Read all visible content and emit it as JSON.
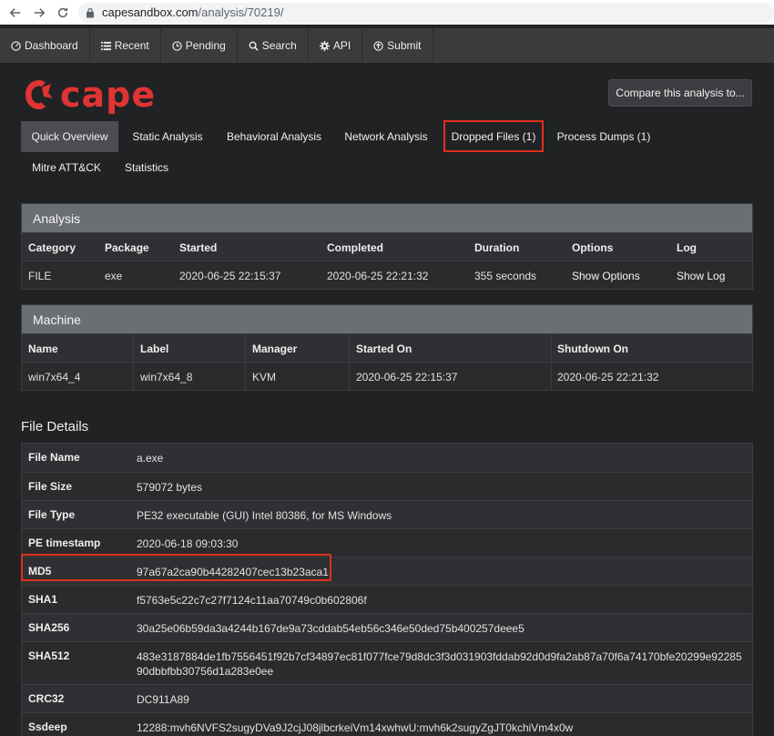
{
  "browser": {
    "url_host": "capesandbox.com",
    "url_path": "/analysis/70219/"
  },
  "nav": [
    {
      "label": "Dashboard",
      "icon": "dashboard-icon"
    },
    {
      "label": "Recent",
      "icon": "list-icon"
    },
    {
      "label": "Pending",
      "icon": "clock-icon"
    },
    {
      "label": "Search",
      "icon": "search-icon"
    },
    {
      "label": "API",
      "icon": "gear-icon"
    },
    {
      "label": "Submit",
      "icon": "upload-icon"
    }
  ],
  "logo_text": "cape",
  "compare_label": "Compare this analysis to...",
  "tabs": [
    {
      "label": "Quick Overview",
      "active": true
    },
    {
      "label": "Static Analysis"
    },
    {
      "label": "Behavioral Analysis"
    },
    {
      "label": "Network Analysis"
    },
    {
      "label": "Dropped Files (1)",
      "highlighted": true
    },
    {
      "label": "Process Dumps (1)"
    },
    {
      "label": "Mitre ATT&CK"
    },
    {
      "label": "Statistics"
    }
  ],
  "analysis": {
    "title": "Analysis",
    "headers": [
      "Category",
      "Package",
      "Started",
      "Completed",
      "Duration",
      "Options",
      "Log"
    ],
    "values": [
      "FILE",
      "exe",
      "2020-06-25 22:15:37",
      "2020-06-25 22:21:32",
      "355 seconds",
      "Show Options",
      "Show Log"
    ]
  },
  "machine": {
    "title": "Machine",
    "headers": [
      "Name",
      "Label",
      "Manager",
      "Started On",
      "Shutdown On"
    ],
    "values": [
      "win7x64_4",
      "win7x64_8",
      "KVM",
      "2020-06-25 22:15:37",
      "2020-06-25 22:21:32"
    ]
  },
  "file_details": {
    "title": "File Details",
    "rows": [
      {
        "key": "File Name",
        "value": "a.exe"
      },
      {
        "key": "File Size",
        "value": "579072 bytes"
      },
      {
        "key": "File Type",
        "value": "PE32 executable (GUI) Intel 80386, for MS Windows"
      },
      {
        "key": "PE timestamp",
        "value": "2020-06-18 09:03:30"
      },
      {
        "key": "MD5",
        "value": "97a67a2ca90b44282407cec13b23aca1",
        "highlighted": true
      },
      {
        "key": "SHA1",
        "value": "f5763e5c22c7c27f7124c11aa70749c0b602806f"
      },
      {
        "key": "SHA256",
        "value": "30a25e06b59da3a4244b167de9a73cddab54eb56c346e50ded75b400257deee5"
      },
      {
        "key": "SHA512",
        "value": "483e3187884de1fb7556451f92b7cf34897ec81f077fce79d8dc3f3d031903fddab92d0d9fa2ab87a70f6a74170bfe20299e9228590dbbfbb30756d1a283e0ee"
      },
      {
        "key": "CRC32",
        "value": "DC911A89"
      },
      {
        "key": "Ssdeep",
        "value": "12288:mvh6NVFS2sugyDVa9J2cjJ08jlbcrkeiVm14xwhwU:mvh6k2sugyZgJT0kchiVm4x0w"
      }
    ]
  },
  "colors": {
    "brand_red": "#e03434",
    "highlight_red": "#e0301e",
    "panel_header": "#6b6e73",
    "background": "#212224"
  }
}
